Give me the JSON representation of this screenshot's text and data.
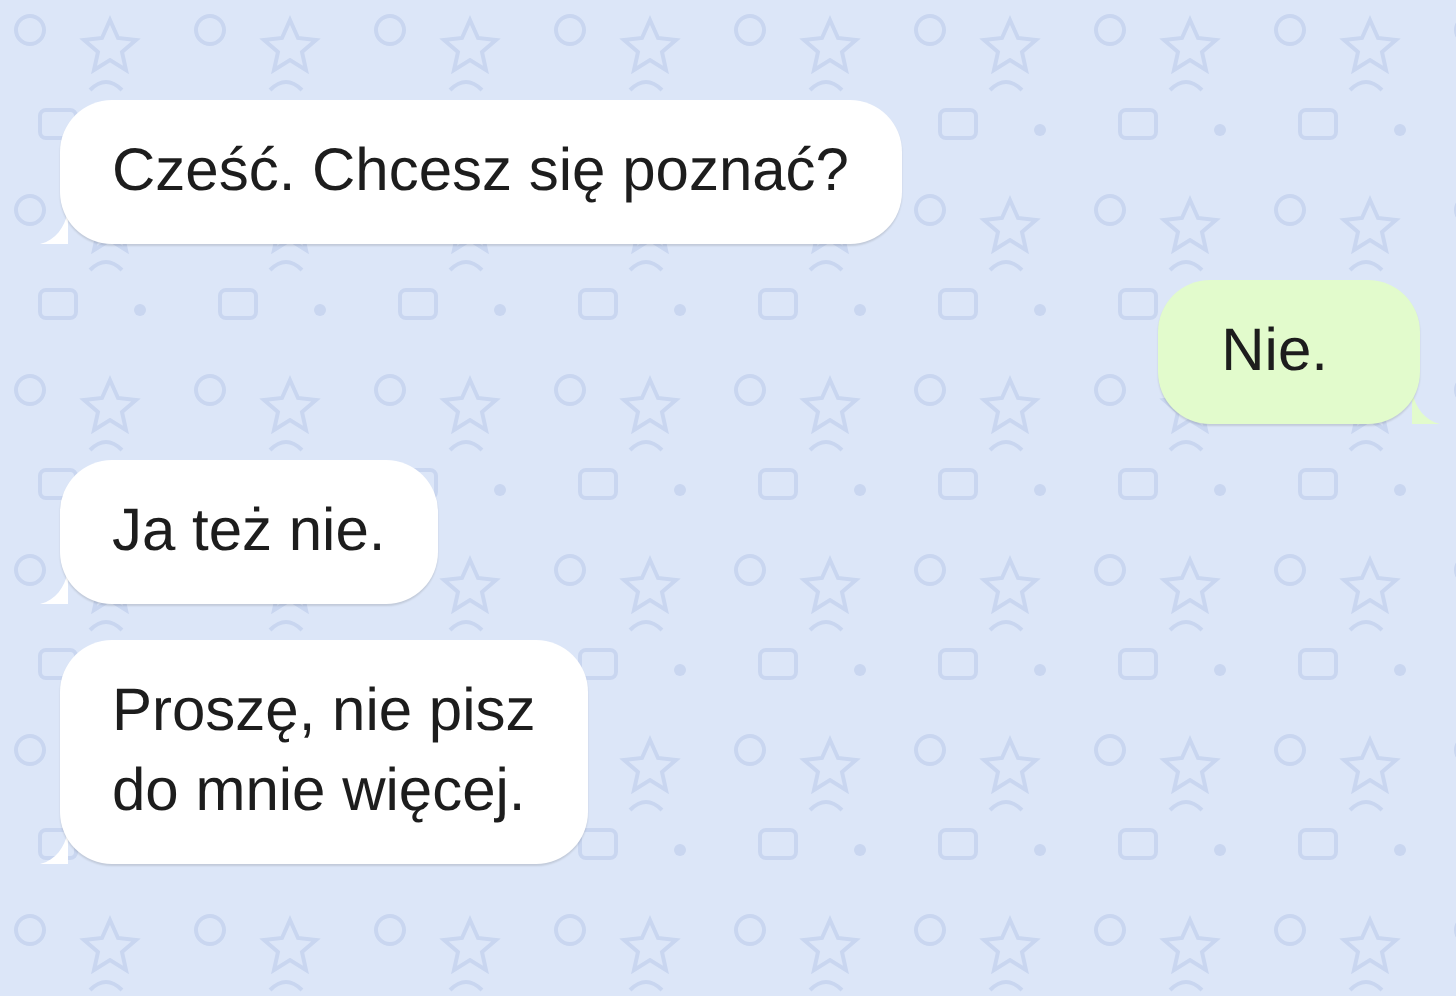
{
  "messages": [
    {
      "kind": "incoming",
      "text": "Cześć. Chcesz się poznać?"
    },
    {
      "kind": "outgoing",
      "text": "Nie."
    },
    {
      "kind": "incoming",
      "text": "Ja też nie."
    },
    {
      "kind": "incoming",
      "text": "Proszę, nie pisz\ndo mnie więcej."
    }
  ]
}
